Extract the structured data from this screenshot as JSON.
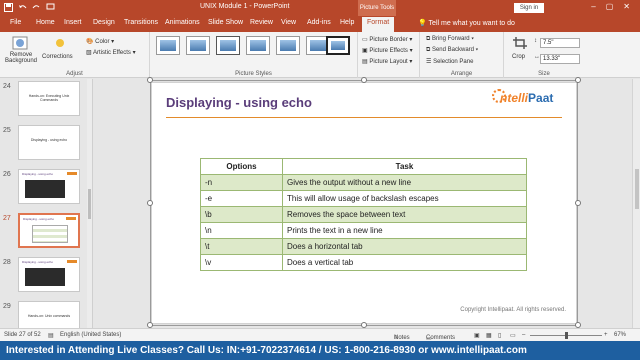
{
  "titlebar": {
    "doc_title": "UNIX Module 1 - PowerPoint",
    "context_label": "Picture Tools",
    "signin_label": "Sign in",
    "share_label": "Share"
  },
  "tabs": [
    "File",
    "Home",
    "Insert",
    "Design",
    "Transitions",
    "Animations",
    "Slide Show",
    "Review",
    "View",
    "Add-ins",
    "Help",
    "Format"
  ],
  "tell_me": "Tell me what you want to do",
  "ribbon": {
    "remove_bg": "Remove Background",
    "corrections": "Corrections",
    "color": "Color",
    "artistic": "Artistic Effects",
    "adjust_label": "Adjust",
    "styles_label": "Picture Styles",
    "border": "Picture Border",
    "effects": "Picture Effects",
    "layout": "Picture Layout",
    "bring_forward": "Bring Forward",
    "send_backward": "Send Backward",
    "selection_pane": "Selection Pane",
    "arrange_label": "Arrange",
    "crop": "Crop",
    "height": "7.5\"",
    "width": "13.33\"",
    "size_label": "Size"
  },
  "slides": [
    {
      "num": "24",
      "caption": "Hands-on: Executing Unix Commands"
    },
    {
      "num": "25",
      "caption": "Displaying - using echo"
    },
    {
      "num": "26",
      "caption": "Displaying - using echo"
    },
    {
      "num": "27",
      "caption": "Displaying - using echo"
    },
    {
      "num": "28",
      "caption": "Displaying - using echo"
    },
    {
      "num": "29",
      "caption": "Hands-on: Unix commands"
    }
  ],
  "slide": {
    "title": "Displaying - using echo",
    "logo_a": "ntelli",
    "logo_b": "Paat",
    "copyright": "Copyright Intellipaat. All rights reserved.",
    "table": {
      "headers": [
        "Options",
        "Task"
      ],
      "rows": [
        [
          "-n",
          "Gives the output without a new line"
        ],
        [
          "-e",
          "This will allow usage of backslash escapes"
        ],
        [
          "\\b",
          "Removes the space between text"
        ],
        [
          "\\n",
          "Prints the text in a new line"
        ],
        [
          "\\t",
          "Does a horizontal tab"
        ],
        [
          "\\v",
          "Does a vertical tab"
        ]
      ]
    }
  },
  "status": {
    "slide_count": "Slide 27 of 52",
    "language": "English (United States)",
    "notes": "Notes",
    "comments": "Comments",
    "zoom": "67%"
  },
  "banner": "Interested in Attending Live Classes? Call Us: IN:+91-7022374614 / US: 1-800-216-8930 or www.intellipaat.com",
  "colors": {
    "ppt_red": "#b7472a",
    "title_purple": "#5a3d7a",
    "table_green": "#dde9c9",
    "banner_blue": "#1e5fa0"
  }
}
